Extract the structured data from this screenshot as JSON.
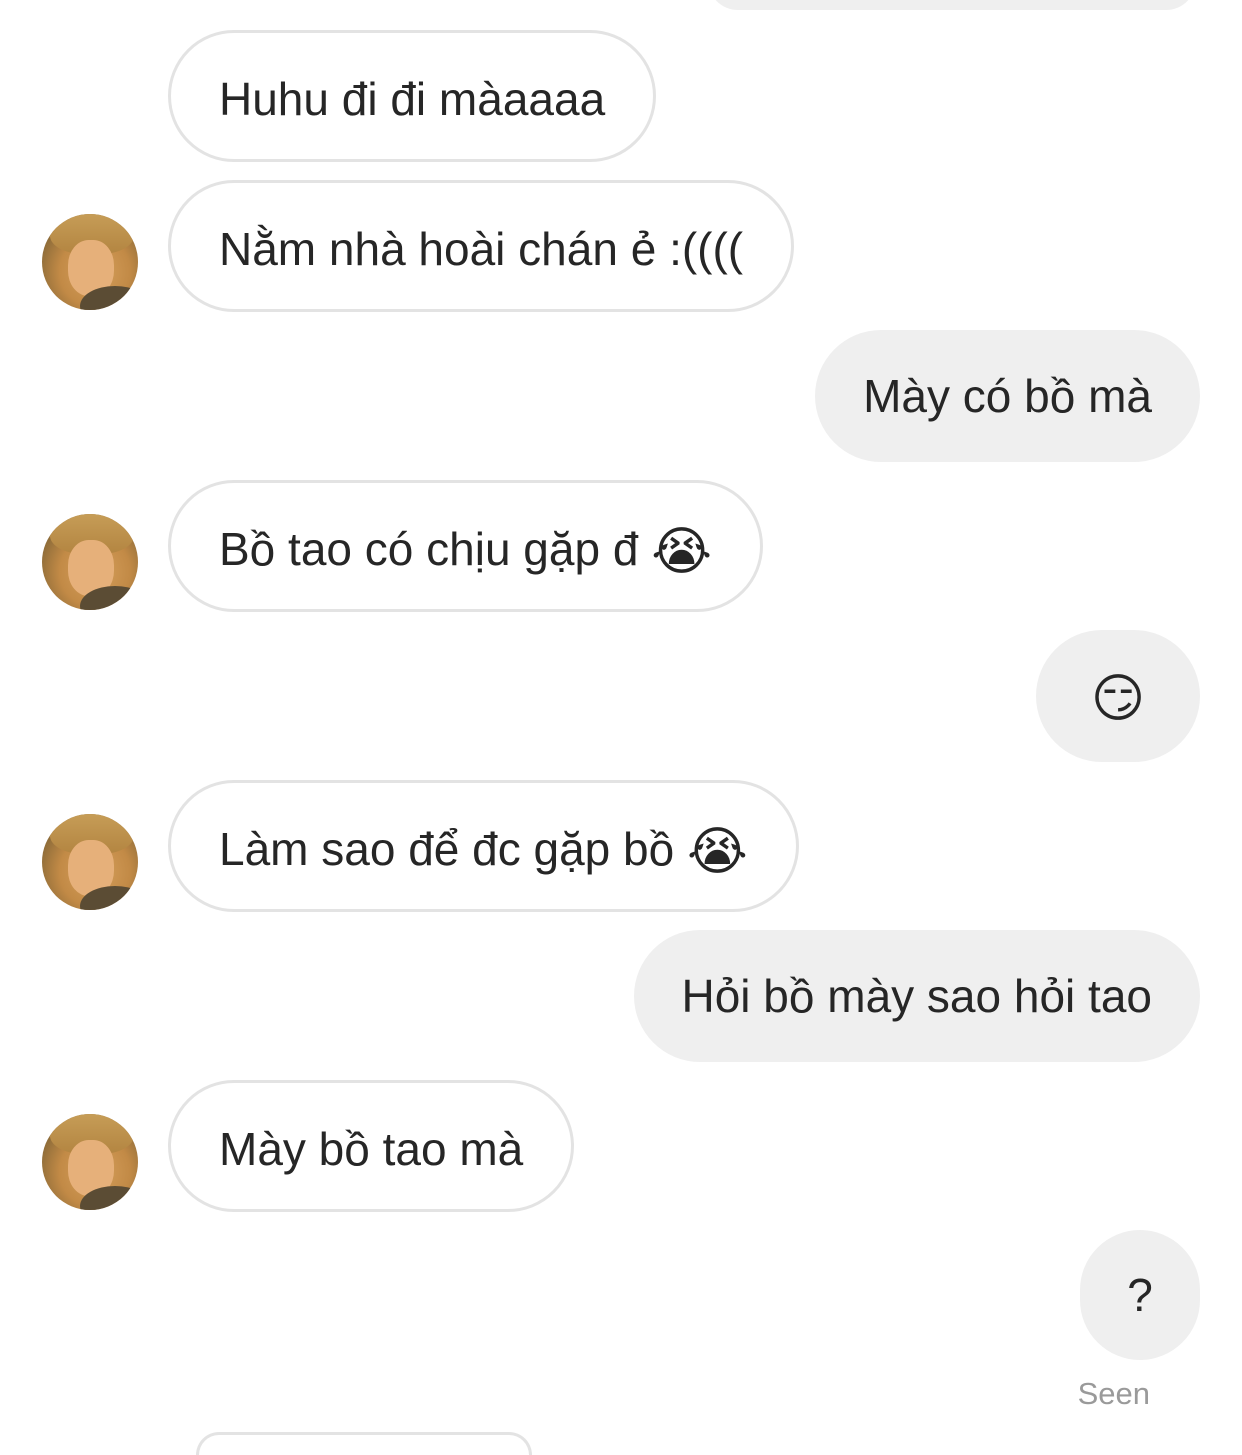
{
  "messages": [
    {
      "text": "Huhu đi đi màaaaa"
    },
    {
      "text": "Nằm nhà hoài chán ẻ :(((("
    },
    {
      "text": "Mày có bồ mà"
    },
    {
      "text": "Bồ tao có chịu gặp đ",
      "emoji": "😭"
    },
    {
      "emoji": "😏"
    },
    {
      "text": "Làm sao để đc gặp bồ",
      "emoji": "😭"
    },
    {
      "text": "Hỏi bồ mày sao hỏi tao"
    },
    {
      "text": "Mày bồ tao mà"
    },
    {
      "text": "?"
    }
  ],
  "status": {
    "seen_label": "Seen"
  }
}
